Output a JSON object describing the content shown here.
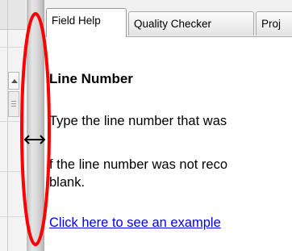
{
  "tabs": [
    {
      "label": "Field Help",
      "active": true
    },
    {
      "label": "Quality Checker",
      "active": false
    },
    {
      "label": "Proj",
      "active": false
    }
  ],
  "help": {
    "title": "Line Number",
    "paragraph1": "Type the line number that was",
    "paragraph2_line1": "f the line number was not reco",
    "paragraph2_line2": "blank.",
    "link_text": "Click here to see an example",
    "link_suffix": ":"
  },
  "icons": {
    "resize": "horizontal-resize-cursor-icon",
    "scroll_up": "scroll-up-arrow-icon"
  },
  "colors": {
    "annotation": "#ff0000",
    "link": "#0000ee",
    "tab_border": "#a9a9a9"
  }
}
